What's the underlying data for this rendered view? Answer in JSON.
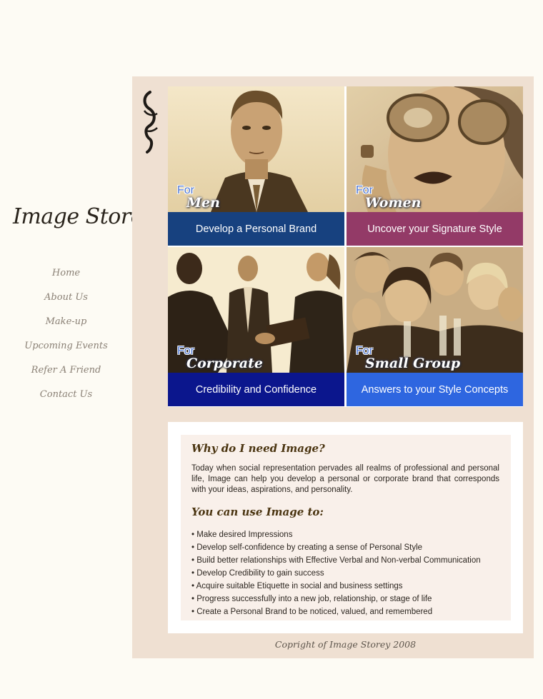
{
  "brand": {
    "logo_text": "Image Storey"
  },
  "nav": [
    {
      "label": "Home"
    },
    {
      "label": "About Us"
    },
    {
      "label": "Make-up"
    },
    {
      "label": "Upcoming Events"
    },
    {
      "label": "Refer A Friend"
    },
    {
      "label": "Contact Us"
    }
  ],
  "tiles": [
    {
      "for": "For",
      "kind": "Men",
      "tagline": "Develop a Personal Brand",
      "band_color": "#17417f"
    },
    {
      "for": "For",
      "kind": "Women",
      "tagline": "Uncover your Signature Style",
      "band_color": "#933a67"
    },
    {
      "for": "For",
      "kind": "Corporate",
      "tagline": "Credibility and Confidence",
      "band_color": "#0b168d"
    },
    {
      "for": "For",
      "kind": "Small Group",
      "tagline": "Answers to your Style Concepts",
      "band_color": "#2e66e0"
    }
  ],
  "content": {
    "heading1": "Why do I need Image?",
    "paragraph": "Today when social representation pervades all realms of professional and personal life, Image can help you develop a personal or corporate brand that corresponds with your ideas, aspirations, and personality.",
    "heading2": "You can use Image to:",
    "bullets": [
      "Make desired Impressions",
      "Develop self-confidence by creating a sense of Personal Style",
      "Build better relationships with Effective Verbal and Non-verbal Communication",
      "Develop Credibility to gain success",
      "Acquire suitable Etiquette in social and business settings",
      "Progress successfully into a new job, relationship, or stage of life",
      "Create a Personal Brand to be  noticed, valued, and remembered"
    ]
  },
  "footer": {
    "copyright": "Copright of Image Storey 2008"
  },
  "colors": {
    "page_bg": "#fdfbf4",
    "panel_bg": "#efe0d2",
    "sepia_light": "#f3e5c3",
    "sepia_dark": "#5b4524"
  }
}
